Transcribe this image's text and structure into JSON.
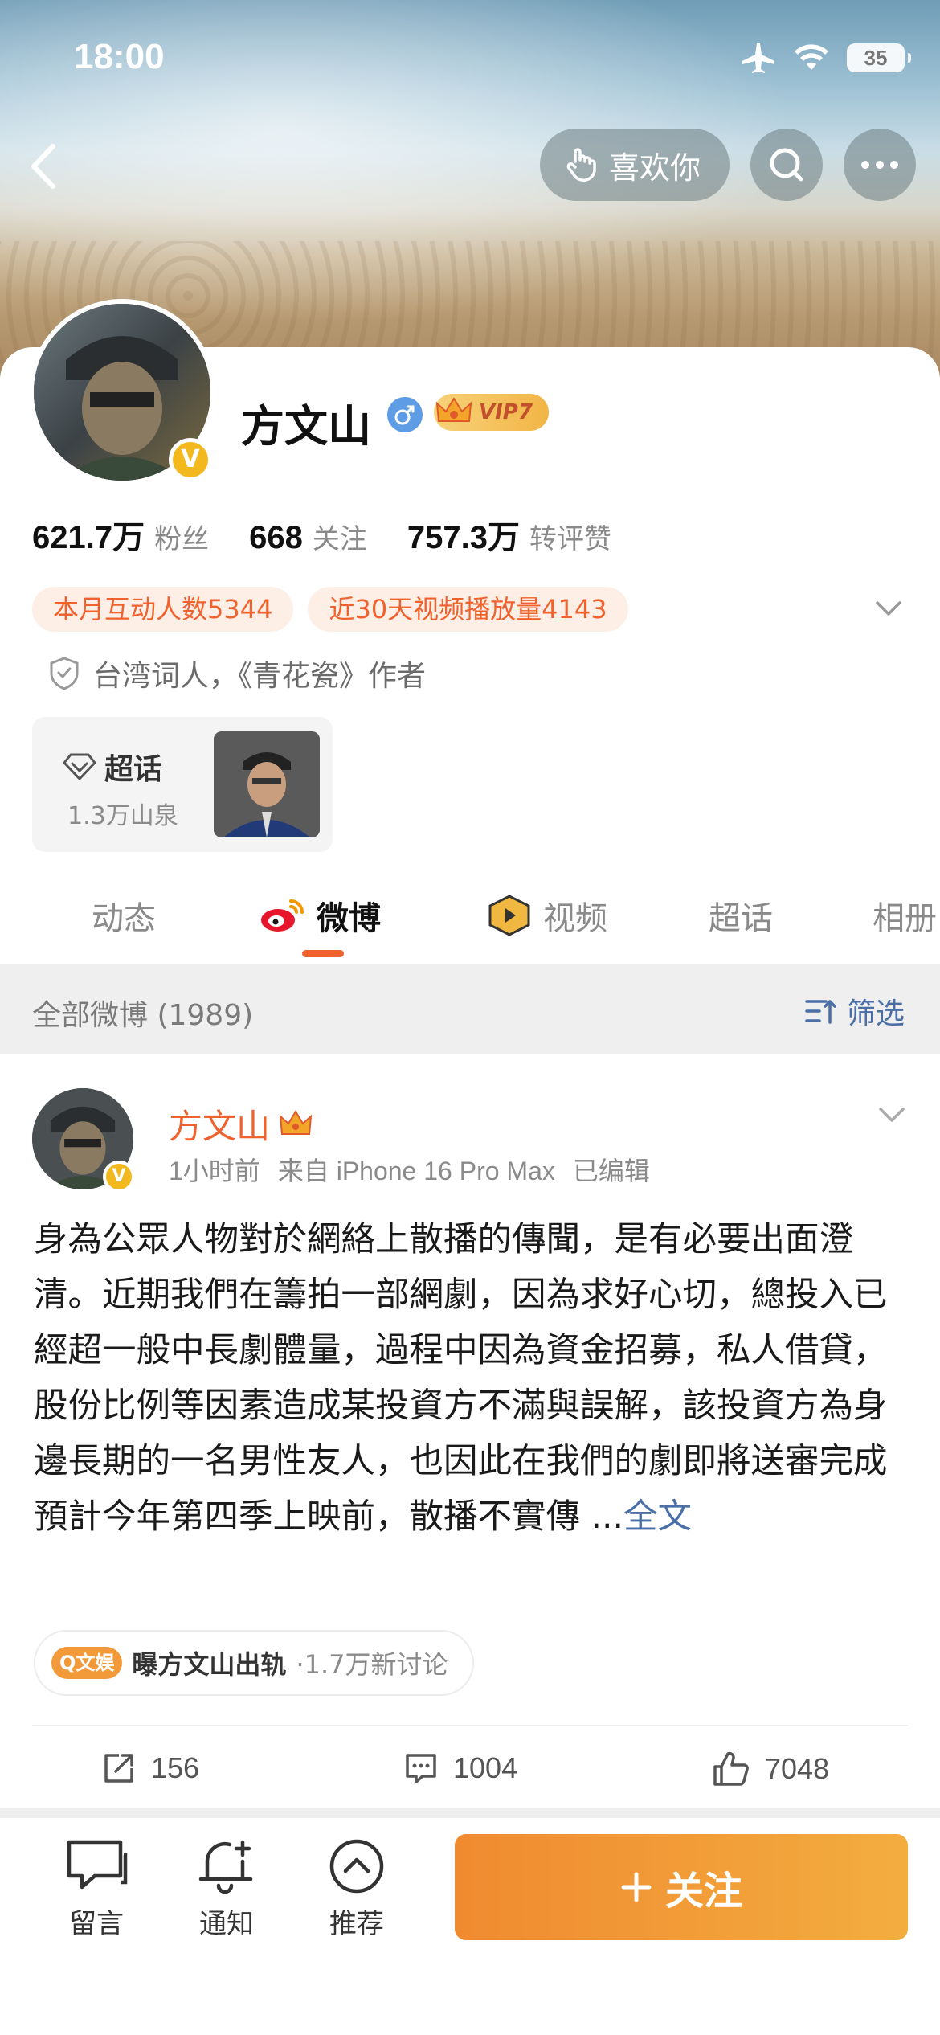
{
  "status_bar": {
    "time": "18:00",
    "battery": "35"
  },
  "header": {
    "like_label": "喜欢你"
  },
  "profile": {
    "name": "方文山",
    "vip_label": "VIP7",
    "avatar_verified_mark": "V",
    "stats": [
      {
        "num": "621.7万",
        "label": "粉丝"
      },
      {
        "num": "668",
        "label": "关注"
      },
      {
        "num": "757.3万",
        "label": "转评赞"
      }
    ],
    "tags": [
      "本月互动人数5344",
      "近30天视频播放量4143"
    ],
    "bio": "台湾词人，《青花瓷》作者",
    "chaohua": {
      "title": "超话",
      "sub": "1.3万山泉"
    }
  },
  "tabs": [
    "动态",
    "微博",
    "视频",
    "超话",
    "相册"
  ],
  "filter": {
    "count_label": "全部微博 (1989)",
    "button_label": "筛选"
  },
  "post": {
    "author": "方文山",
    "verified_mark": "V",
    "time": "1小时前",
    "source": "来自 iPhone 16 Pro Max",
    "edited": "已编辑",
    "text": "身為公眾人物對於網絡上散播的傳聞，是有必要出面澄清。近期我們在籌拍一部網劇，因為求好心切，總投入已經超一般中長劇體量，過程中因為資金招募，私人借貸，股份比例等因素造成某投資方不滿與誤解，該投資方為身邊長期的一名男性友人，也因此在我們的劇即將送審完成預計今年第四季上映前，散播不實傳 ...",
    "more_label": "全文",
    "topic": {
      "badge": "Q文娱",
      "title": "曝方文山出轨",
      "sub": "·1.7万新讨论"
    },
    "actions": {
      "repost": "156",
      "comment": "1004",
      "like": "7048"
    }
  },
  "bottom_bar": {
    "items": [
      "留言",
      "通知",
      "推荐"
    ],
    "follow_label": "关注"
  },
  "colors": {
    "accent": "#f0622d",
    "link": "#4a6ea6",
    "follow": "#f08a30"
  }
}
